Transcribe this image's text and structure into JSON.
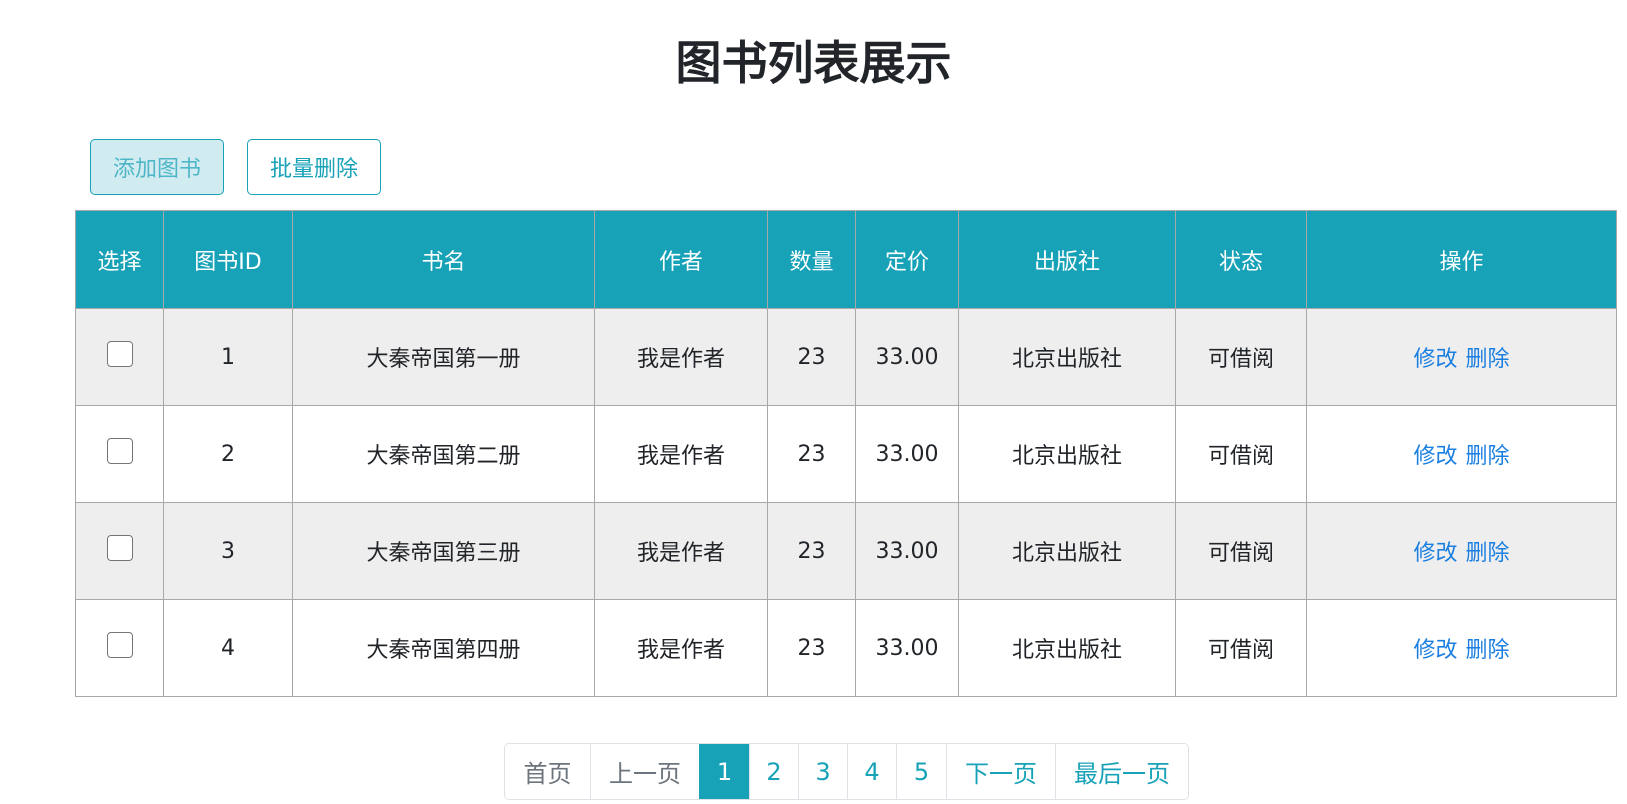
{
  "page": {
    "title": "图书列表展示"
  },
  "toolbar": {
    "add_label": "添加图书",
    "batch_delete_label": "批量删除"
  },
  "table": {
    "headers": [
      "选择",
      "图书ID",
      "书名",
      "作者",
      "数量",
      "定价",
      "出版社",
      "状态",
      "操作"
    ],
    "rows": [
      {
        "id": "1",
        "name": "大秦帝国第一册",
        "author": "我是作者",
        "count": "23",
        "price": "33.00",
        "publisher": "北京出版社",
        "status": "可借阅",
        "edit": "修改",
        "delete": "删除"
      },
      {
        "id": "2",
        "name": "大秦帝国第二册",
        "author": "我是作者",
        "count": "23",
        "price": "33.00",
        "publisher": "北京出版社",
        "status": "可借阅",
        "edit": "修改",
        "delete": "删除"
      },
      {
        "id": "3",
        "name": "大秦帝国第三册",
        "author": "我是作者",
        "count": "23",
        "price": "33.00",
        "publisher": "北京出版社",
        "status": "可借阅",
        "edit": "修改",
        "delete": "删除"
      },
      {
        "id": "4",
        "name": "大秦帝国第四册",
        "author": "我是作者",
        "count": "23",
        "price": "33.00",
        "publisher": "北京出版社",
        "status": "可借阅",
        "edit": "修改",
        "delete": "删除"
      }
    ]
  },
  "pagination": {
    "first": "首页",
    "prev": "上一页",
    "pages": [
      "1",
      "2",
      "3",
      "4",
      "5"
    ],
    "current": "1",
    "next": "下一页",
    "last": "最后一页"
  },
  "colors": {
    "accent": "#17a2b8",
    "link": "#1a7fe0",
    "stripe": "#eeeeee"
  }
}
